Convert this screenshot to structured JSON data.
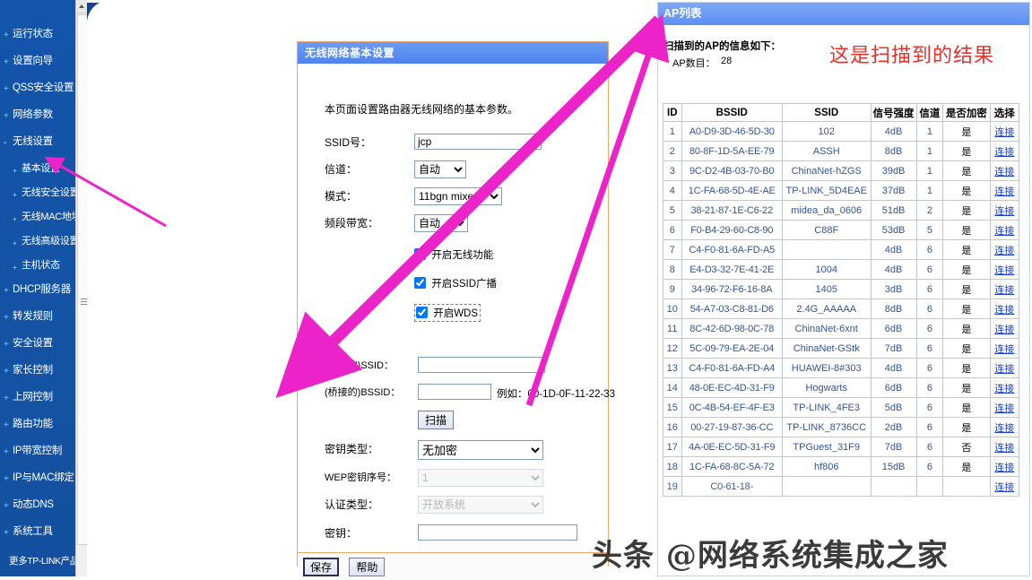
{
  "sidebar": {
    "items": [
      {
        "label": "运行状态",
        "level": 0,
        "marker": "+"
      },
      {
        "label": "设置向导",
        "level": 0,
        "marker": "+"
      },
      {
        "label": "QSS安全设置",
        "level": 0,
        "marker": "+"
      },
      {
        "label": "网络参数",
        "level": 0,
        "marker": "+"
      },
      {
        "label": "无线设置",
        "level": 0,
        "marker": "-"
      },
      {
        "label": "基本设置",
        "level": 1,
        "marker": "+",
        "selected": true
      },
      {
        "label": "无线安全设置",
        "level": 1,
        "marker": "+"
      },
      {
        "label": "无线MAC地址过滤",
        "level": 1,
        "marker": "+"
      },
      {
        "label": "无线高级设置",
        "level": 1,
        "marker": "+"
      },
      {
        "label": "主机状态",
        "level": 1,
        "marker": "+"
      },
      {
        "label": "DHCP服务器",
        "level": 0,
        "marker": "+"
      },
      {
        "label": "转发规则",
        "level": 0,
        "marker": "+"
      },
      {
        "label": "安全设置",
        "level": 0,
        "marker": "+"
      },
      {
        "label": "家长控制",
        "level": 0,
        "marker": "+"
      },
      {
        "label": "上网控制",
        "level": 0,
        "marker": "+"
      },
      {
        "label": "路由功能",
        "level": 0,
        "marker": "+"
      },
      {
        "label": "IP带宽控制",
        "level": 0,
        "marker": "+"
      },
      {
        "label": "IP与MAC绑定",
        "level": 0,
        "marker": "+"
      },
      {
        "label": "动态DNS",
        "level": 0,
        "marker": "+"
      },
      {
        "label": "系统工具",
        "level": 0,
        "marker": "+"
      }
    ],
    "footer": "更多TP-LINK产品。"
  },
  "form": {
    "title": "无线网络基本设置",
    "intro": "本页面设置路由器无线网络的基本参数。",
    "fields": {
      "ssid_label": "SSID号：",
      "ssid_value": "jcp",
      "channel_label": "信道：",
      "channel_value": "自动",
      "mode_label": "模式：",
      "mode_value": "11bgn mixed",
      "bandwidth_label": "频段带宽：",
      "bandwidth_value": "自动",
      "bridge_ssid_label": "(桥接的)SSID：",
      "bridge_ssid_value": "",
      "bridge_bssid_label": "(桥接的)BSSID：",
      "bridge_bssid_value": "",
      "bssid_example": "例如：00-1D-0F-11-22-33",
      "key_type_label": "密钥类型：",
      "key_type_value": "无加密",
      "wep_index_label": "WEP密钥序号：",
      "wep_index_value": "1",
      "auth_type_label": "认证类型：",
      "auth_type_value": "开放系统",
      "key_label": "密钥：",
      "key_value": ""
    },
    "checkboxes": [
      {
        "label": "开启无线功能",
        "checked": true
      },
      {
        "label": "开启SSID广播",
        "checked": true
      },
      {
        "label": "开启WDS",
        "checked": true
      }
    ],
    "scan_button": "扫描",
    "save_button": "保存",
    "help_button": "帮助"
  },
  "ap_list": {
    "title": "AP列表",
    "subtitle": "扫描到的AP的信息如下：",
    "count_label": "AP数目：",
    "count_value": "28",
    "annotation": "这是扫描到的结果",
    "columns": [
      "ID",
      "BSSID",
      "SSID",
      "信号强度",
      "信道",
      "是否加密",
      "选择"
    ],
    "connect_label": "连接",
    "rows": [
      {
        "id": "1",
        "bssid": "A0-D9-3D-46-5D-30",
        "ssid": "102",
        "signal": "4dB",
        "channel": "1",
        "encrypted": "是"
      },
      {
        "id": "2",
        "bssid": "80-8F-1D-5A-EE-79",
        "ssid": "ASSH",
        "signal": "8dB",
        "channel": "1",
        "encrypted": "是"
      },
      {
        "id": "3",
        "bssid": "9C-D2-4B-03-70-B0",
        "ssid": "ChinaNet-hZGS",
        "signal": "39dB",
        "channel": "1",
        "encrypted": "是"
      },
      {
        "id": "4",
        "bssid": "1C-FA-68-5D-4E-AE",
        "ssid": "TP-LINK_5D4EAE",
        "signal": "37dB",
        "channel": "1",
        "encrypted": "是"
      },
      {
        "id": "5",
        "bssid": "38-21-87-1E-C6-22",
        "ssid": "midea_da_0606",
        "signal": "51dB",
        "channel": "2",
        "encrypted": "是"
      },
      {
        "id": "6",
        "bssid": "F0-B4-29-60-C8-90",
        "ssid": "C88F",
        "signal": "53dB",
        "channel": "5",
        "encrypted": "是"
      },
      {
        "id": "7",
        "bssid": "C4-F0-81-6A-FD-A5",
        "ssid": "",
        "signal": "4dB",
        "channel": "6",
        "encrypted": "是"
      },
      {
        "id": "8",
        "bssid": "E4-D3-32-7E-41-2E",
        "ssid": "1004",
        "signal": "4dB",
        "channel": "6",
        "encrypted": "是"
      },
      {
        "id": "9",
        "bssid": "34-96-72-F6-16-8A",
        "ssid": "1405",
        "signal": "3dB",
        "channel": "6",
        "encrypted": "是"
      },
      {
        "id": "10",
        "bssid": "54-A7-03-C8-81-D6",
        "ssid": "2.4G_AAAAA",
        "signal": "8dB",
        "channel": "6",
        "encrypted": "是"
      },
      {
        "id": "11",
        "bssid": "8C-42-6D-98-0C-78",
        "ssid": "ChinaNet-6xnt",
        "signal": "6dB",
        "channel": "6",
        "encrypted": "是"
      },
      {
        "id": "12",
        "bssid": "5C-09-79-EA-2E-04",
        "ssid": "ChinaNet-GStk",
        "signal": "7dB",
        "channel": "6",
        "encrypted": "是"
      },
      {
        "id": "13",
        "bssid": "C4-F0-81-6A-FD-A4",
        "ssid": "HUAWEI-8#303",
        "signal": "4dB",
        "channel": "6",
        "encrypted": "是"
      },
      {
        "id": "14",
        "bssid": "48-0E-EC-4D-31-F9",
        "ssid": "Hogwarts",
        "signal": "6dB",
        "channel": "6",
        "encrypted": "是"
      },
      {
        "id": "15",
        "bssid": "0C-4B-54-EF-4F-E3",
        "ssid": "TP-LINK_4FE3",
        "signal": "5dB",
        "channel": "6",
        "encrypted": "是"
      },
      {
        "id": "16",
        "bssid": "00-27-19-87-36-CC",
        "ssid": "TP-LINK_8736CC",
        "signal": "2dB",
        "channel": "6",
        "encrypted": "是"
      },
      {
        "id": "17",
        "bssid": "4A-0E-EC-5D-31-F9",
        "ssid": "TPGuest_31F9",
        "signal": "7dB",
        "channel": "6",
        "encrypted": "否"
      },
      {
        "id": "18",
        "bssid": "1C-FA-68-8C-5A-72",
        "ssid": "hf806",
        "signal": "15dB",
        "channel": "6",
        "encrypted": "是"
      },
      {
        "id": "19",
        "bssid": "C0-61-18-",
        "ssid": "",
        "signal": "",
        "channel": "",
        "encrypted": ""
      }
    ]
  },
  "watermark": {
    "text": "头条 @网络系统集成之家"
  },
  "colors": {
    "sidebar_blue": "#1254a8",
    "panel_header_blue": "#5b8ff0",
    "form_border_orange": "#f0a868",
    "annotation_red": "#e8312a",
    "arrow_magenta": "#ec23c8",
    "link_blue": "#1a3fd0",
    "table_text_blue": "#33559b"
  }
}
